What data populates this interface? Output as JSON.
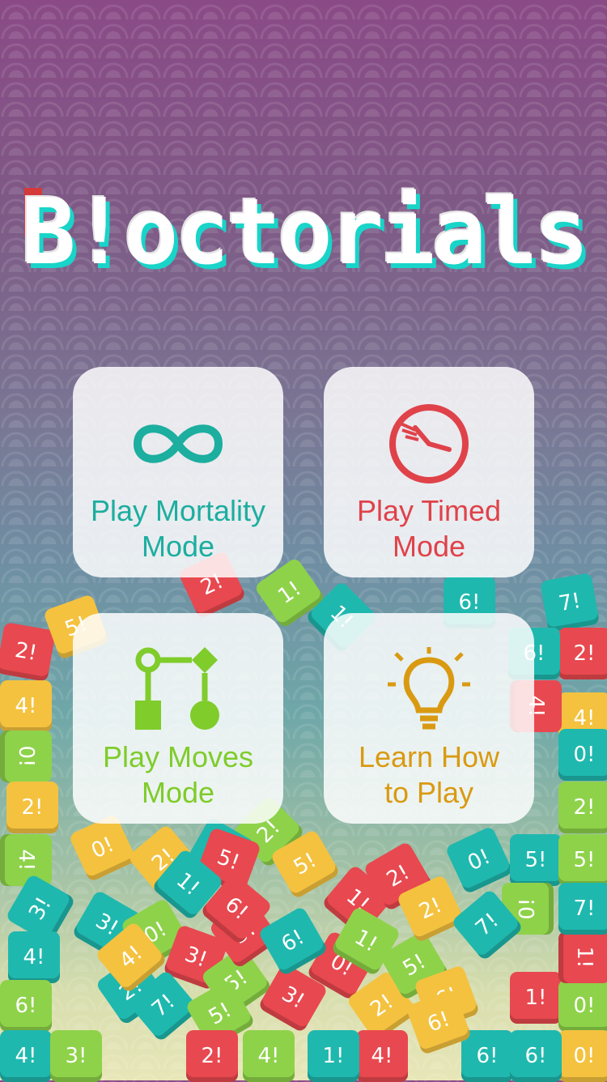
{
  "title": "B!octorials",
  "menu": {
    "mortality": {
      "label": "Play Mortality\nMode",
      "color": "#1cae9f",
      "icon": "infinity-icon"
    },
    "timed": {
      "label": "Play Timed\nMode",
      "color": "#e0424a",
      "icon": "stopwatch-icon"
    },
    "moves": {
      "label": "Play Moves\nMode",
      "color": "#7fcc2b",
      "icon": "flowchart-icon"
    },
    "learn": {
      "label": "Learn How\nto Play",
      "color": "#d99a12",
      "icon": "lightbulb-icon"
    }
  },
  "tiles": [
    {
      "t": "2!",
      "c": "red"
    },
    {
      "t": "5!",
      "c": "yellow"
    },
    {
      "t": "1!",
      "c": "green"
    },
    {
      "t": "1!",
      "c": "teal"
    },
    {
      "t": "6!",
      "c": "teal"
    },
    {
      "t": "7!",
      "c": "teal"
    },
    {
      "t": "2!",
      "c": "red"
    },
    {
      "t": "6!",
      "c": "teal"
    },
    {
      "t": "2!",
      "c": "red"
    },
    {
      "t": "4!",
      "c": "yellow"
    },
    {
      "t": "0!",
      "c": "green"
    },
    {
      "t": "2!",
      "c": "yellow"
    },
    {
      "t": "4!",
      "c": "green"
    },
    {
      "t": "3!",
      "c": "teal"
    },
    {
      "t": "4!",
      "c": "teal"
    },
    {
      "t": "6!",
      "c": "green"
    },
    {
      "t": "4!",
      "c": "teal"
    },
    {
      "t": "3!",
      "c": "green"
    },
    {
      "t": "2!",
      "c": "teal"
    },
    {
      "t": "0!",
      "c": "yellow"
    },
    {
      "t": "2!",
      "c": "green"
    },
    {
      "t": "2!",
      "c": "yellow"
    },
    {
      "t": "6!",
      "c": "teal"
    },
    {
      "t": "3!",
      "c": "teal"
    },
    {
      "t": "0!",
      "c": "green"
    },
    {
      "t": "4!",
      "c": "yellow"
    },
    {
      "t": "3!",
      "c": "red"
    },
    {
      "t": "5!",
      "c": "green"
    },
    {
      "t": "3!",
      "c": "red"
    },
    {
      "t": "0!",
      "c": "red"
    },
    {
      "t": "2!",
      "c": "yellow"
    },
    {
      "t": "5!",
      "c": "green"
    },
    {
      "t": "0!",
      "c": "teal"
    },
    {
      "t": "6!",
      "c": "yellow"
    },
    {
      "t": "5!",
      "c": "red"
    },
    {
      "t": "1!",
      "c": "red"
    },
    {
      "t": "5!",
      "c": "red"
    },
    {
      "t": "1!",
      "c": "teal"
    },
    {
      "t": "5!",
      "c": "yellow"
    },
    {
      "t": "1!",
      "c": "red"
    },
    {
      "t": "2!",
      "c": "red"
    },
    {
      "t": "2!",
      "c": "yellow"
    },
    {
      "t": "5!",
      "c": "teal"
    },
    {
      "t": "0!",
      "c": "green"
    },
    {
      "t": "7!",
      "c": "teal"
    },
    {
      "t": "0!",
      "c": "green"
    },
    {
      "t": "6!",
      "c": "teal"
    },
    {
      "t": "1!",
      "c": "red"
    },
    {
      "t": "0!",
      "c": "yellow"
    },
    {
      "t": "4!",
      "c": "red"
    },
    {
      "t": "7!",
      "c": "teal"
    },
    {
      "t": "6!",
      "c": "red"
    },
    {
      "t": "5!",
      "c": "green"
    },
    {
      "t": "4!",
      "c": "yellow"
    },
    {
      "t": "0!",
      "c": "teal"
    },
    {
      "t": "2!",
      "c": "green"
    },
    {
      "t": "5!",
      "c": "green"
    },
    {
      "t": "6!",
      "c": "teal"
    },
    {
      "t": "7!",
      "c": "teal"
    },
    {
      "t": "6!",
      "c": "yellow"
    },
    {
      "t": "4!",
      "c": "green"
    },
    {
      "t": "1!",
      "c": "teal"
    },
    {
      "t": "4!",
      "c": "red"
    },
    {
      "t": "6!",
      "c": "teal"
    },
    {
      "t": "1!",
      "c": "green"
    },
    {
      "t": "2!",
      "c": "red"
    }
  ]
}
